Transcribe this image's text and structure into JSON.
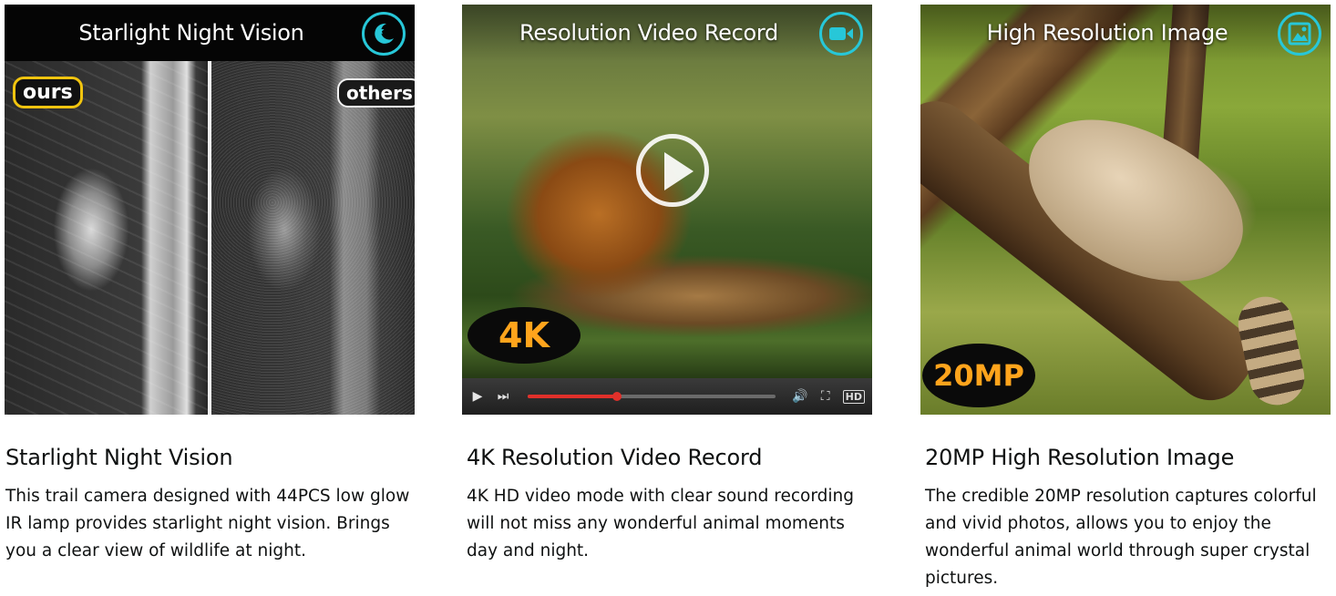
{
  "cards": [
    {
      "banner": "Starlight Night Vision",
      "icon": "moon-star-icon",
      "labels": {
        "ours": "ours",
        "others": "others"
      },
      "title": "Starlight Night Vision",
      "description": "This trail camera designed with 44PCS low glow IR lamp provides starlight night vision. Brings you a clear view of wildlife at night."
    },
    {
      "banner": "Resolution Video Record",
      "icon": "video-camera-icon",
      "badge": "4K",
      "player": {
        "progress": 0.36,
        "hd_label": "HD"
      },
      "title": "4K Resolution Video Record",
      "description": "4K HD video mode with clear sound recording will not miss any wonderful animal moments day and night."
    },
    {
      "banner": "High Resolution Image",
      "icon": "picture-icon",
      "badge": "20MP",
      "title": "20MP High Resolution Image",
      "description": "The credible 20MP resolution captures colorful and vivid photos, allows you to enjoy the wonderful animal world through super crystal pictures."
    }
  ],
  "colors": {
    "accent_cyan": "#27c7d8",
    "badge_orange": "#ffa41c",
    "progress_red": "#e0302a",
    "ours_yellow": "#f1c40f"
  }
}
